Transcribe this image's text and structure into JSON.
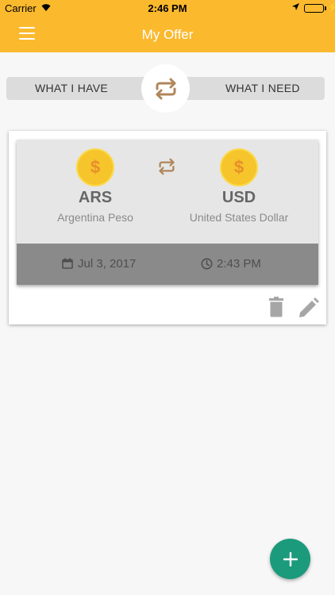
{
  "status_bar": {
    "carrier": "Carrier",
    "time": "2:46 PM",
    "battery_color": "#3cb043"
  },
  "nav": {
    "title": "My Offer",
    "menu_icon": "hamburger-icon",
    "bar_color": "#fbb92e"
  },
  "toggle": {
    "left_label": "WHAT I HAVE",
    "right_label": "WHAT I NEED",
    "swap_icon": "swap-arrows-icon"
  },
  "offer": {
    "have": {
      "code": "ARS",
      "name": "Argentina Peso",
      "icon": "dollar-coin-icon"
    },
    "need": {
      "code": "USD",
      "name": "United States Dollar",
      "icon": "dollar-coin-icon"
    },
    "date": "Jul 3, 2017",
    "time": "2:43 PM",
    "coin_symbol": "$",
    "actions": [
      "delete-icon",
      "edit-icon"
    ]
  },
  "fab": {
    "icon": "plus-icon",
    "color": "#1c9a7c"
  }
}
